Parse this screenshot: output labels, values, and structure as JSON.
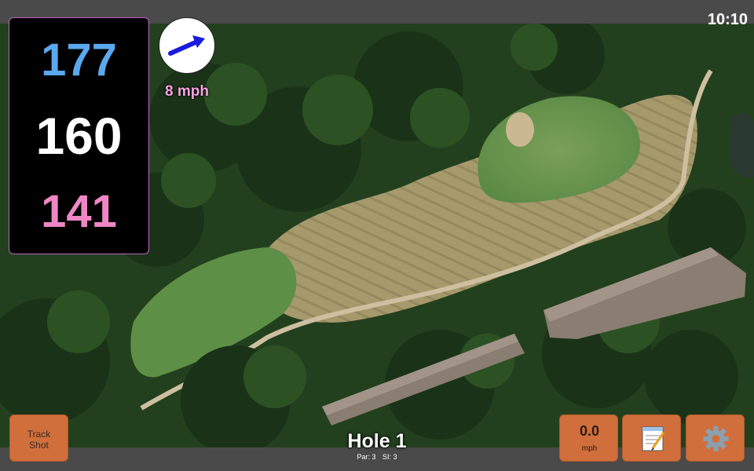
{
  "status": {
    "time": "10:10"
  },
  "distances": {
    "back": "177",
    "middle": "160",
    "front": "141"
  },
  "wind": {
    "speed_label": "8 mph",
    "direction_icon": "arrow-icon",
    "arrow_color": "#1a1ae0"
  },
  "buttons": {
    "track_shot_line1": "Track",
    "track_shot_line2": "Shot",
    "speed_value": "0.0",
    "speed_unit": "mph",
    "notes_icon": "notepad-icon",
    "settings_icon": "gear-icon"
  },
  "hole": {
    "title": "Hole 1",
    "par_label": "Par: 3",
    "si_label": "SI: 3"
  },
  "colors": {
    "button": "#d06f3c",
    "back_distance": "#5aa8ee",
    "front_distance": "#ef86c5",
    "wind_text": "#f6a4e0"
  }
}
